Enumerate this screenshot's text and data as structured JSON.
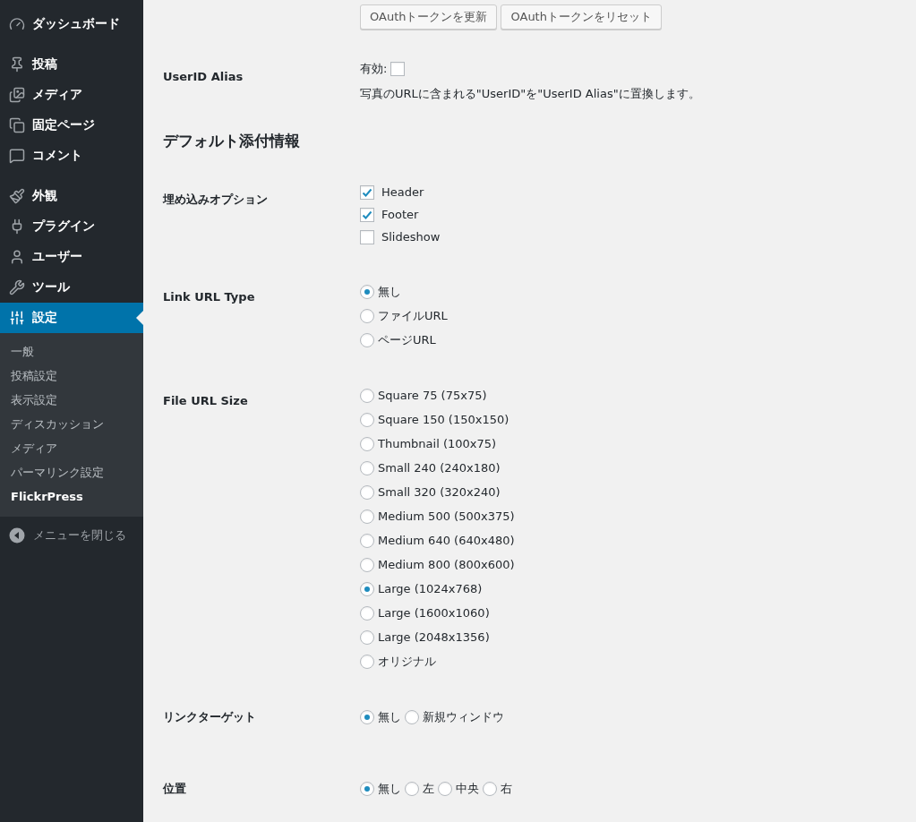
{
  "sidebar": {
    "groups": [
      {
        "items": [
          {
            "label": "ダッシュボード",
            "selected": false
          }
        ]
      },
      {
        "items": [
          {
            "label": "投稿",
            "selected": false
          },
          {
            "label": "メディア",
            "selected": false
          },
          {
            "label": "固定ページ",
            "selected": false
          },
          {
            "label": "コメント",
            "selected": false
          }
        ]
      },
      {
        "items": [
          {
            "label": "外観",
            "selected": false
          },
          {
            "label": "プラグイン",
            "selected": false
          },
          {
            "label": "ユーザー",
            "selected": false
          },
          {
            "label": "ツール",
            "selected": false
          },
          {
            "label": "設定",
            "selected": true
          }
        ]
      }
    ],
    "submenu": [
      {
        "label": "一般",
        "selected": false
      },
      {
        "label": "投稿設定",
        "selected": false
      },
      {
        "label": "表示設定",
        "selected": false
      },
      {
        "label": "ディスカッション",
        "selected": false
      },
      {
        "label": "メディア",
        "selected": false
      },
      {
        "label": "パーマリンク設定",
        "selected": false
      },
      {
        "label": "FlickrPress",
        "selected": true
      }
    ],
    "collapse": "メニューを閉じる"
  },
  "sections": [
    {
      "kind": "buttons",
      "buttons": [
        "OAuthトークンを更新",
        "OAuthトークンをリセット"
      ]
    },
    {
      "kind": "toggle",
      "label": "UserID Alias",
      "option": "有効:",
      "checked": false,
      "description": "写真のURLに含まれる\"UserID\"を\"UserID Alias\"に置換します。"
    },
    {
      "kind": "heading",
      "title": "デフォルト添付情報"
    },
    {
      "kind": "checkboxes",
      "label": "埋め込みオプション",
      "options": [
        {
          "label": "Header",
          "checked": true
        },
        {
          "label": "Footer",
          "checked": true
        },
        {
          "label": "Slideshow",
          "checked": false
        }
      ]
    },
    {
      "kind": "radios",
      "label": "Link URL Type",
      "options": [
        {
          "label": "無し",
          "selected": true
        },
        {
          "label": "ファイルURL",
          "selected": false
        },
        {
          "label": "ページURL",
          "selected": false
        }
      ]
    },
    {
      "kind": "radios",
      "label": "File URL Size",
      "options": [
        {
          "label": "Square 75 (75x75)",
          "selected": false
        },
        {
          "label": "Square 150 (150x150)",
          "selected": false
        },
        {
          "label": "Thumbnail (100x75)",
          "selected": false
        },
        {
          "label": "Small 240 (240x180)",
          "selected": false
        },
        {
          "label": "Small 320 (320x240)",
          "selected": false
        },
        {
          "label": "Medium 500 (500x375)",
          "selected": false
        },
        {
          "label": "Medium 640 (640x480)",
          "selected": false
        },
        {
          "label": "Medium 800 (800x600)",
          "selected": false
        },
        {
          "label": "Large (1024x768)",
          "selected": true
        },
        {
          "label": "Large (1600x1060)",
          "selected": false
        },
        {
          "label": "Large (2048x1356)",
          "selected": false
        },
        {
          "label": "オリジナル",
          "selected": false
        }
      ]
    },
    {
      "kind": "radios_inline",
      "label": "リンクターゲット",
      "options": [
        {
          "label": "無し",
          "selected": true
        },
        {
          "label": "新規ウィンドウ",
          "selected": false
        }
      ]
    },
    {
      "kind": "radios_inline",
      "label": "位置",
      "options": [
        {
          "label": "無し",
          "selected": true
        },
        {
          "label": "左",
          "selected": false
        },
        {
          "label": "中央",
          "selected": false
        },
        {
          "label": "右",
          "selected": false
        }
      ]
    }
  ]
}
